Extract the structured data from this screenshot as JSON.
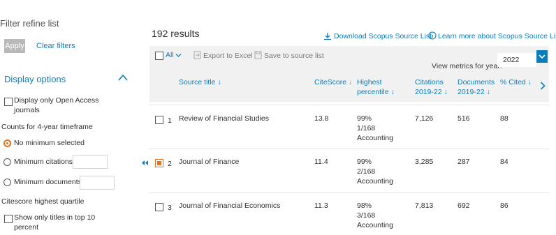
{
  "filters": {
    "title": "Filter refine list",
    "apply_label": "Apply",
    "clear_label": "Clear filters",
    "display_options_label": "Display options",
    "open_access_label_1": "Display only Open Access",
    "open_access_label_2": "journals",
    "timeframe_label": "Counts for 4-year timeframe",
    "no_minimum_label": "No minimum selected",
    "min_citations_label": "Minimum citations",
    "min_documents_label": "Minimum documents",
    "quartile_label": "Citescore highest quartile",
    "top10_label_1": "Show only titles in top 10",
    "top10_label_2": "percent"
  },
  "results": {
    "count_text": "192 results",
    "download_label": "Download Scopus Source List",
    "learn_label": "Learn more about Scopus Source List"
  },
  "toolbar": {
    "all_label": "All",
    "export_label": "Export to Excel",
    "save_label": "Save to source list",
    "metrics_label": "View metrics for year:",
    "year_value": "2022"
  },
  "table": {
    "headers": {
      "source_title": "Source title",
      "citescore": "CiteScore",
      "highest_1": "Highest",
      "highest_2": "percentile",
      "citations_1": "Citations",
      "citations_2": "2019-22",
      "documents_1": "Documents",
      "documents_2": "2019-22",
      "cited": "% Cited"
    },
    "rows": [
      {
        "num": "1",
        "title": "Review of Financial Studies",
        "citescore": "13.8",
        "pct": "99%",
        "rank": "1/168",
        "category": "Accounting",
        "citations": "7,126",
        "documents": "516",
        "cited": "88"
      },
      {
        "num": "2",
        "title": "Journal of Finance",
        "citescore": "11.4",
        "pct": "99%",
        "rank": "2/168",
        "category": "Accounting",
        "citations": "3,285",
        "documents": "287",
        "cited": "84"
      },
      {
        "num": "3",
        "title": "Journal of Financial Economics",
        "citescore": "11.3",
        "pct": "98%",
        "rank": "3/168",
        "category": "Accounting",
        "citations": "7,813",
        "documents": "692",
        "cited": "86"
      }
    ]
  },
  "colors": {
    "link": "#0c7dbb",
    "accent": "#e9711c",
    "toolbar_bg": "#f1f1f1"
  }
}
